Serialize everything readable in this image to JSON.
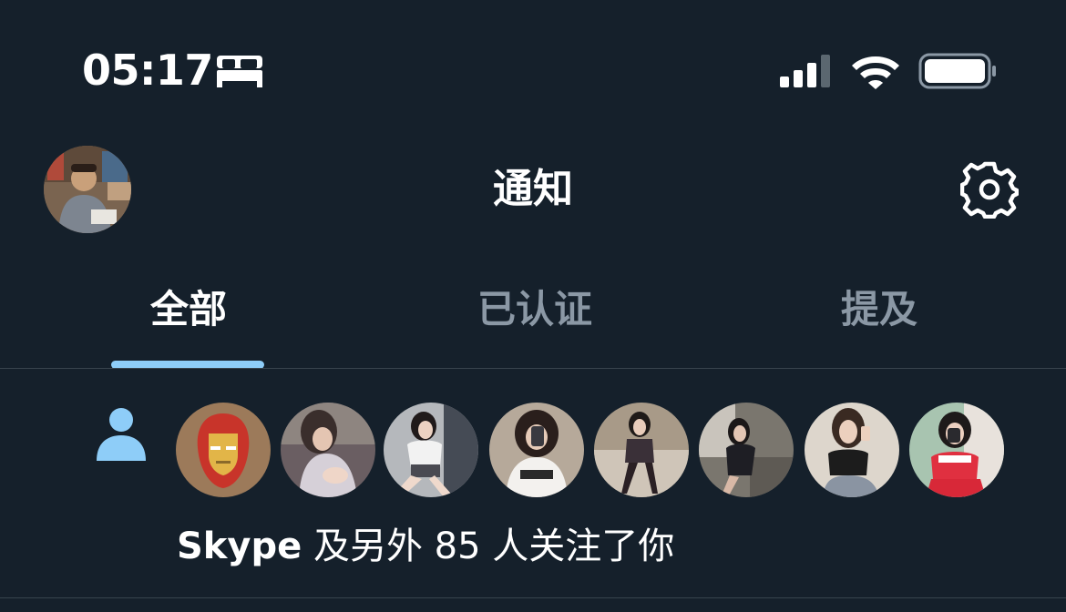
{
  "status_bar": {
    "time": "05:17",
    "focus_icon": "bed-icon",
    "signal_icon": "cellular-signal-icon",
    "wifi_icon": "wifi-icon",
    "battery_icon": "battery-icon"
  },
  "header": {
    "title": "通知",
    "avatar_icon": "profile-avatar",
    "settings_icon": "gear-icon"
  },
  "tabs": [
    {
      "label": "全部",
      "active": true
    },
    {
      "label": "已认证",
      "active": false
    },
    {
      "label": "提及",
      "active": false
    }
  ],
  "notification": {
    "icon": "person-icon",
    "name": "Skype",
    "text": " 及另外 85 人关注了你",
    "avatar_count": 8
  },
  "colors": {
    "background": "#15202b",
    "accent": "#8ecdf8",
    "inactive_tab": "#8b98a5",
    "divider": "#38444d"
  }
}
